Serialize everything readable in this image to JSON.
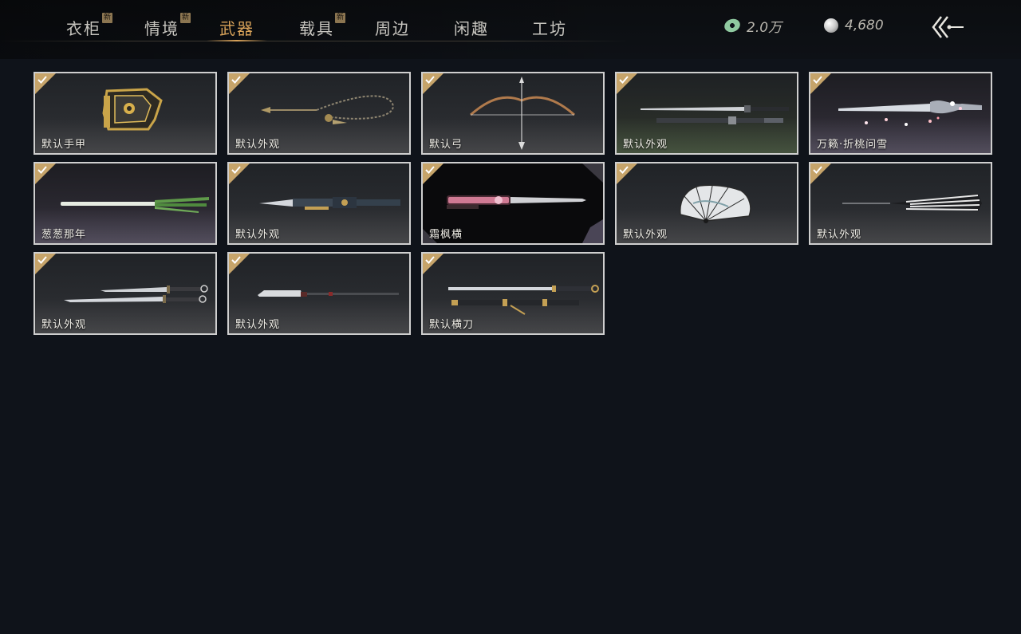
{
  "tabs": [
    {
      "label": "衣柜",
      "badge": "新",
      "active": false
    },
    {
      "label": "情境",
      "badge": "新",
      "active": false
    },
    {
      "label": "武器",
      "badge": "",
      "active": true
    },
    {
      "label": "载具",
      "badge": "新",
      "active": false
    },
    {
      "label": "周边",
      "badge": "",
      "active": false
    },
    {
      "label": "闲趣",
      "badge": "",
      "active": false
    },
    {
      "label": "工坊",
      "badge": "",
      "active": false
    }
  ],
  "currency": {
    "jade_amount": "2.0万",
    "pearl_amount": "4,680",
    "jade_icon": "jade-coin-icon",
    "pearl_icon": "pearl-icon"
  },
  "items": [
    {
      "label": "默认手甲",
      "owned": true,
      "icon": "gauntlet"
    },
    {
      "label": "默认外观",
      "owned": true,
      "icon": "rope-dart"
    },
    {
      "label": "默认弓",
      "owned": true,
      "icon": "bow"
    },
    {
      "label": "默认外观",
      "owned": true,
      "icon": "sword-pair"
    },
    {
      "label": "万籁·折桃问雪",
      "owned": true,
      "icon": "ornate-blade"
    },
    {
      "label": "葱葱那年",
      "owned": true,
      "icon": "scallion-sword"
    },
    {
      "label": "默认外观",
      "owned": true,
      "icon": "mechanical-spear"
    },
    {
      "label": "霜枫横",
      "owned": true,
      "icon": "pink-blade"
    },
    {
      "label": "默认外观",
      "owned": true,
      "icon": "folding-fan"
    },
    {
      "label": "默认外观",
      "owned": true,
      "icon": "striped-umbrella"
    },
    {
      "label": "默认外观",
      "owned": true,
      "icon": "dual-blades"
    },
    {
      "label": "默认外观",
      "owned": true,
      "icon": "glaive"
    },
    {
      "label": "默认横刀",
      "owned": true,
      "icon": "hengdao"
    }
  ],
  "colors": {
    "accent": "#d9a35a",
    "check": "#c6a46a",
    "background": "#0f131a"
  }
}
